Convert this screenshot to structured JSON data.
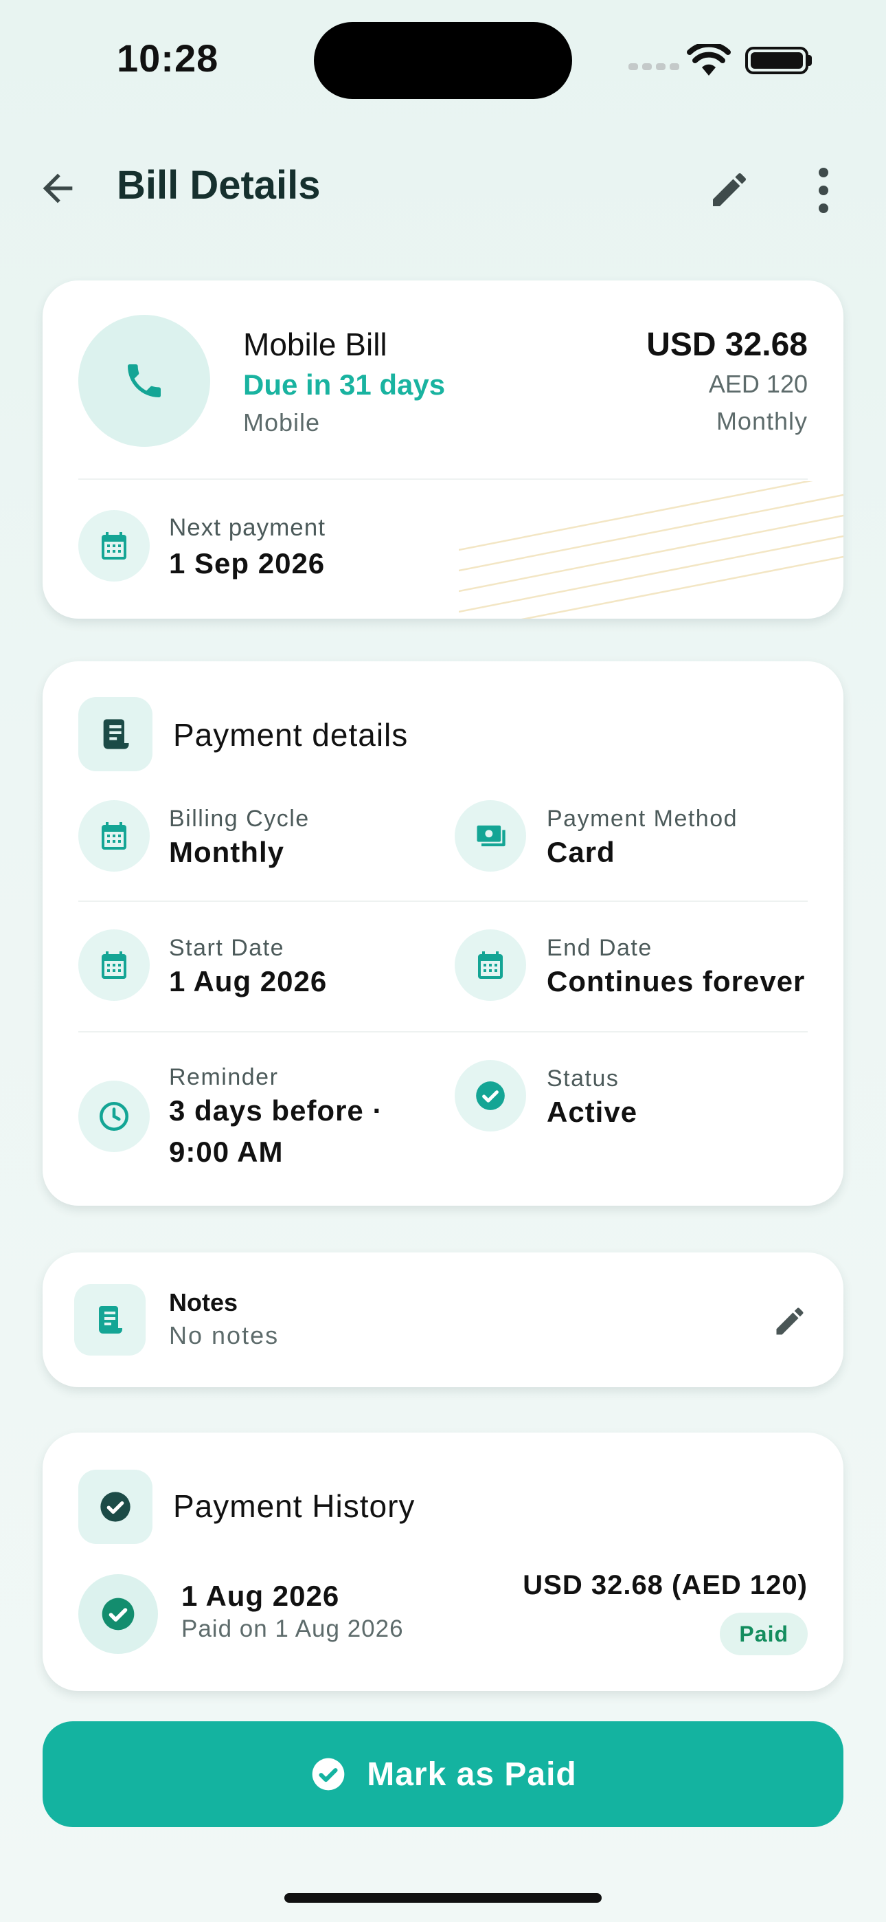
{
  "status_bar": {
    "time": "10:28"
  },
  "header": {
    "title": "Bill Details"
  },
  "bill": {
    "name": "Mobile Bill",
    "due": "Due in 31 days",
    "category": "Mobile",
    "amount_primary": "USD 32.68",
    "amount_secondary": "AED 120",
    "frequency": "Monthly",
    "next_payment_label": "Next payment",
    "next_payment_value": "1 Sep 2026"
  },
  "payment_details": {
    "title": "Payment details",
    "items": [
      {
        "label": "Billing Cycle",
        "value": "Monthly",
        "icon": "calendar-icon"
      },
      {
        "label": "Payment Method",
        "value": "Card",
        "icon": "cash-icon"
      },
      {
        "label": "Start Date",
        "value": "1 Aug 2026",
        "icon": "calendar-icon"
      },
      {
        "label": "End Date",
        "value": "Continues forever",
        "icon": "calendar-icon"
      },
      {
        "label": "Reminder",
        "value": "3 days before ·",
        "value_line2": "9:00 AM",
        "icon": "clock-icon"
      },
      {
        "label": "Status",
        "value": "Active",
        "icon": "check-circle-icon"
      }
    ]
  },
  "notes": {
    "title": "Notes",
    "text": "No notes"
  },
  "history": {
    "title": "Payment History",
    "entries": [
      {
        "date": "1 Aug 2026",
        "paid_on": "Paid on 1 Aug 2026",
        "amount": "USD 32.68 (AED 120)",
        "badge": "Paid"
      }
    ]
  },
  "actions": {
    "mark_paid": "Mark as Paid"
  },
  "colors": {
    "accent": "#14b3a0",
    "accent_text": "#19b3a0",
    "paid_badge_text": "#138d5e",
    "icon_bg": "#e2f4f1"
  }
}
